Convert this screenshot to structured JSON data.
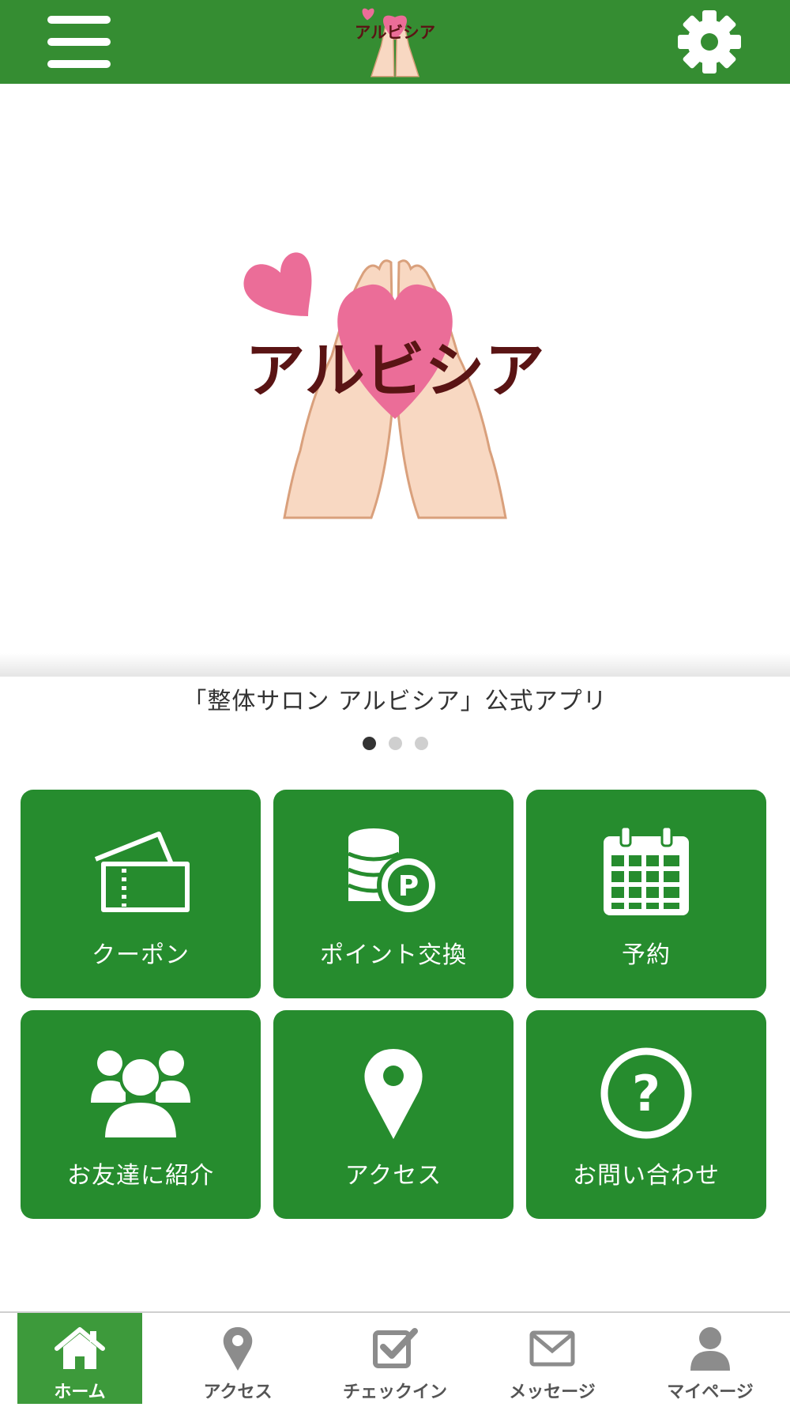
{
  "header": {
    "logo_text": "アルビシア",
    "menu_icon": "hamburger-menu-icon",
    "settings_icon": "gear-icon"
  },
  "hero": {
    "logo_text": "アルビシア",
    "caption": "「整体サロン アルビシア」公式アプリ",
    "slides_total": 3,
    "active_slide": 1
  },
  "tiles": [
    {
      "label": "クーポン",
      "icon": "ticket-icon"
    },
    {
      "label": "ポイント交換",
      "icon": "coin-points-icon"
    },
    {
      "label": "予約",
      "icon": "calendar-icon"
    },
    {
      "label": "お友達に紹介",
      "icon": "users-group-icon"
    },
    {
      "label": "アクセス",
      "icon": "map-pin-icon"
    },
    {
      "label": "お問い合わせ",
      "icon": "question-circle-icon"
    }
  ],
  "bottom_nav": [
    {
      "label": "ホーム",
      "icon": "home-icon",
      "active": true
    },
    {
      "label": "アクセス",
      "icon": "map-pin-icon",
      "active": false
    },
    {
      "label": "チェックイン",
      "icon": "checkbox-icon",
      "active": false
    },
    {
      "label": "メッセージ",
      "icon": "envelope-icon",
      "active": false
    },
    {
      "label": "マイページ",
      "icon": "user-icon",
      "active": false
    }
  ],
  "colors": {
    "header_green": "#358d32",
    "tile_green": "#268c2e",
    "nav_active_green": "#3d9a3b",
    "heart_pink": "#eb6d98",
    "logo_text_brown": "#5a1414",
    "hand_skin": "#f8d8c2"
  }
}
